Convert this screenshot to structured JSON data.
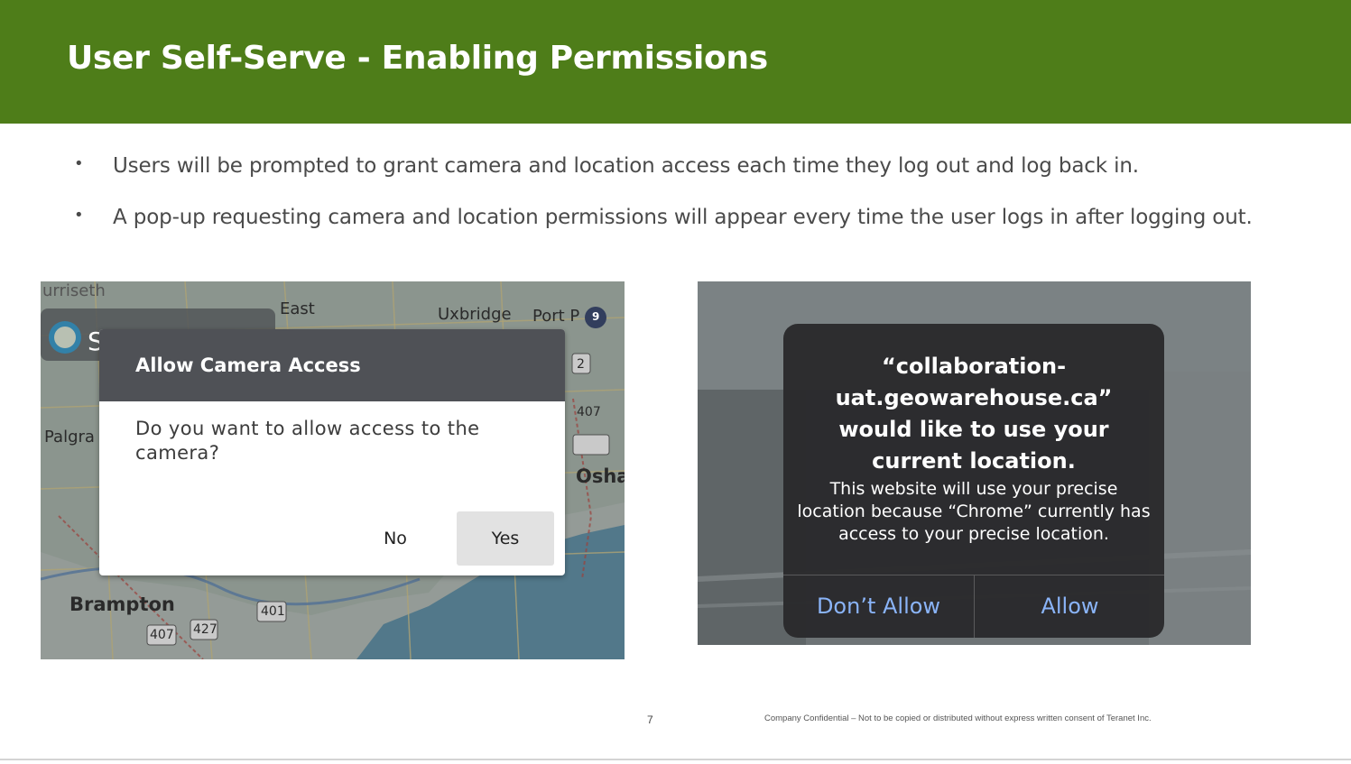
{
  "slide": {
    "title": "User Self-Serve - Enabling Permissions",
    "bullets": [
      "Users will be prompted to grant camera and location access each time they log out and log back in.",
      "A pop-up requesting camera and location permissions will appear every time the user logs in after logging out."
    ],
    "bullet_symbol": "•",
    "page_number": "7",
    "footer": "Company Confidential – Not to be copied or distributed without express written consent of Teranet Inc.",
    "header_color": "#4e7d19"
  },
  "camera_dialog": {
    "title": "Allow Camera Access",
    "message": "Do you want to allow access to the camera?",
    "no_label": "No",
    "yes_label": "Yes",
    "map_labels": {
      "palgrave": "Palgra",
      "brampton": "Brampton",
      "oshawa": "Osha",
      "east": "East",
      "uxbridge": "Uxbridge",
      "port_perry": "Port P",
      "top_cut": "urriseth",
      "hwy_401": "401",
      "hwy_407a": "407",
      "hwy_407b": "407",
      "hwy_427": "427",
      "hwy_2": "2",
      "layer_badge": "9",
      "app_letter": "S"
    }
  },
  "location_alert": {
    "title": "“collaboration-uat.geowarehouse.ca” would like to use your current location.",
    "body": "This website will use your precise location because “Chrome” currently has access to your precise location.",
    "dont_allow_label": "Don’t Allow",
    "allow_label": "Allow",
    "button_color": "#8ab4f8"
  }
}
